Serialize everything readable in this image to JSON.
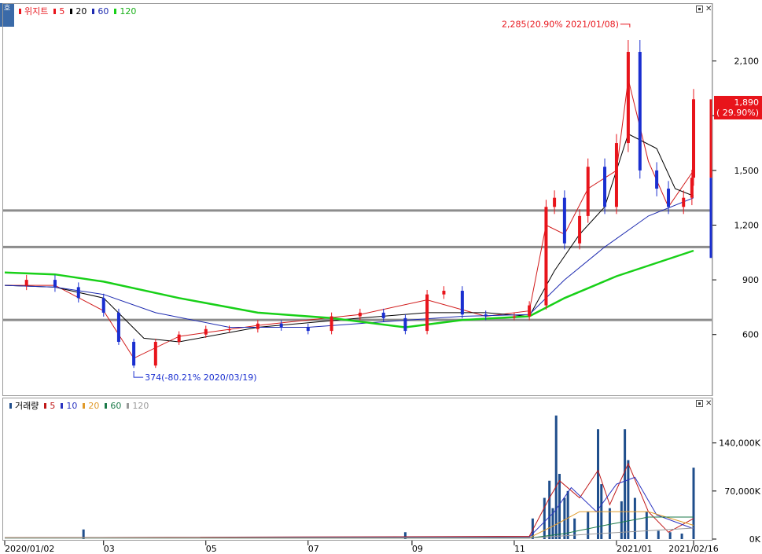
{
  "legend_price": {
    "title": "위지트",
    "ma5": "5",
    "ma20": "20",
    "ma60": "60",
    "ma120": "120"
  },
  "legend_volume": {
    "title": "거래량",
    "ma5": "5",
    "ma10": "10",
    "ma20": "20",
    "ma60": "60",
    "ma120": "120"
  },
  "badge": "호",
  "price_tag": {
    "price": "1,890",
    "change": "( 29.90%)"
  },
  "annotations": {
    "high": "2,285(20.90% 2021/01/08)",
    "low": "374(-80.21% 2020/03/19)"
  },
  "colors": {
    "up": "#e8141b",
    "down": "#1a2fd0",
    "ma5": "#d11a1a",
    "ma20": "#000000",
    "ma60": "#1e2bb0",
    "ma120": "#18d018",
    "hline": "#8c8c8c",
    "vol": "#1f4e8c",
    "vma5": "#c01818",
    "vma10": "#2a33c0",
    "vma20": "#e09a2a",
    "vma60": "#1b7a4a",
    "vma120": "#999999"
  },
  "chart_data": [
    {
      "type": "line",
      "panel": "price",
      "yticks": [
        "2,100",
        "1,800",
        "1,500",
        "1,200",
        "900",
        "600"
      ],
      "ytick_values": [
        2100,
        1800,
        1500,
        1200,
        900,
        600
      ],
      "ylim": [
        280,
        2400
      ],
      "xlabels": [
        "2020/01/02",
        "03",
        "05",
        "07",
        "09",
        "11",
        "2021/01",
        "2021/02/16"
      ],
      "xlabel_dates": [
        "2020-01-02",
        "2020-03-01",
        "2020-05-01",
        "2020-07-01",
        "2020-09-01",
        "2020-11-01",
        "2021-01-01",
        "2021-02-16"
      ],
      "horizontal_lines": [
        1280,
        1080,
        680
      ],
      "high": {
        "date": "2021-01-08",
        "value": 2285
      },
      "low": {
        "date": "2020-03-19",
        "value": 374
      },
      "last": {
        "date": "2021-02-16",
        "value": 1890
      },
      "series": [
        {
          "name": "종가",
          "dates": [
            "2020-01-02",
            "2020-01-15",
            "2020-02-01",
            "2020-02-15",
            "2020-03-01",
            "2020-03-10",
            "2020-03-19",
            "2020-04-01",
            "2020-04-15",
            "2020-05-01",
            "2020-05-15",
            "2020-06-01",
            "2020-06-15",
            "2020-07-01",
            "2020-07-15",
            "2020-08-01",
            "2020-08-15",
            "2020-08-28",
            "2020-09-10",
            "2020-09-20",
            "2020-10-01",
            "2020-10-15",
            "2020-11-01",
            "2020-11-10",
            "2020-11-20",
            "2020-11-25",
            "2020-12-01",
            "2020-12-10",
            "2020-12-15",
            "2020-12-25",
            "2021-01-01",
            "2021-01-08",
            "2021-01-15",
            "2021-01-25",
            "2021-02-01",
            "2021-02-10",
            "2021-02-15",
            "2021-02-16"
          ],
          "values": [
            870,
            900,
            860,
            800,
            720,
            560,
            430,
            560,
            600,
            630,
            630,
            660,
            640,
            620,
            700,
            720,
            690,
            620,
            820,
            840,
            710,
            700,
            700,
            760,
            1300,
            1350,
            1100,
            1250,
            1520,
            1300,
            1650,
            2150,
            1500,
            1400,
            1300,
            1350,
            1460,
            1890
          ]
        },
        {
          "name": "5",
          "dates": [
            "2020-01-02",
            "2020-02-01",
            "2020-03-01",
            "2020-03-19",
            "2020-04-15",
            "2020-06-01",
            "2020-08-01",
            "2020-09-10",
            "2020-10-15",
            "2020-11-10",
            "2020-11-20",
            "2020-12-01",
            "2020-12-15",
            "2021-01-01",
            "2021-01-08",
            "2021-01-20",
            "2021-02-01",
            "2021-02-16"
          ],
          "values": [
            870,
            870,
            730,
            470,
            590,
            650,
            710,
            790,
            700,
            730,
            1200,
            1150,
            1400,
            1500,
            2000,
            1550,
            1300,
            1500
          ]
        },
        {
          "name": "20",
          "dates": [
            "2020-01-02",
            "2020-02-01",
            "2020-03-01",
            "2020-03-25",
            "2020-04-15",
            "2020-06-01",
            "2020-08-01",
            "2020-09-10",
            "2020-10-15",
            "2020-11-10",
            "2020-11-25",
            "2020-12-10",
            "2020-12-25",
            "2021-01-08",
            "2021-01-25",
            "2021-02-05",
            "2021-02-16"
          ],
          "values": [
            870,
            860,
            800,
            580,
            560,
            640,
            690,
            720,
            720,
            700,
            950,
            1150,
            1300,
            1700,
            1620,
            1400,
            1360
          ]
        },
        {
          "name": "60",
          "dates": [
            "2020-01-02",
            "2020-02-01",
            "2020-03-01",
            "2020-04-01",
            "2020-05-15",
            "2020-07-01",
            "2020-08-15",
            "2020-10-01",
            "2020-11-10",
            "2020-12-01",
            "2020-12-25",
            "2021-01-20",
            "2021-02-16"
          ],
          "values": [
            870,
            860,
            820,
            720,
            640,
            640,
            670,
            700,
            710,
            900,
            1080,
            1250,
            1350
          ]
        },
        {
          "name": "120",
          "dates": [
            "2020-01-02",
            "2020-02-01",
            "2020-03-01",
            "2020-04-15",
            "2020-06-01",
            "2020-07-15",
            "2020-08-28",
            "2020-10-01",
            "2020-11-10",
            "2020-12-01",
            "2021-01-01",
            "2021-02-16"
          ],
          "values": [
            940,
            930,
            890,
            800,
            720,
            690,
            640,
            680,
            700,
            800,
            920,
            1060
          ]
        }
      ]
    },
    {
      "type": "bar",
      "panel": "volume",
      "yticks": [
        "140,000K",
        "70,000K",
        "0K"
      ],
      "ytick_values": [
        140000,
        70000,
        0
      ],
      "ylim": [
        0,
        190000
      ],
      "series": [
        {
          "name": "거래량",
          "dates": [
            "2020-02-18",
            "2020-08-28",
            "2020-11-12",
            "2020-11-19",
            "2020-11-22",
            "2020-11-24",
            "2020-11-26",
            "2020-11-28",
            "2020-12-01",
            "2020-12-03",
            "2020-12-07",
            "2020-12-15",
            "2020-12-21",
            "2020-12-23",
            "2020-12-28",
            "2021-01-04",
            "2021-01-06",
            "2021-01-08",
            "2021-01-12",
            "2021-01-19",
            "2021-01-26",
            "2021-02-02",
            "2021-02-09",
            "2021-02-16"
          ],
          "values": [
            14000,
            10000,
            30000,
            60000,
            85000,
            45000,
            180000,
            95000,
            60000,
            70000,
            30000,
            40000,
            160000,
            80000,
            45000,
            55000,
            160000,
            115000,
            60000,
            40000,
            12000,
            10000,
            8000,
            104000
          ]
        },
        {
          "name": "5",
          "dates": [
            "2020-01-02",
            "2020-11-10",
            "2020-11-22",
            "2020-11-28",
            "2020-12-10",
            "2020-12-21",
            "2020-12-28",
            "2021-01-08",
            "2021-01-20",
            "2021-02-01",
            "2021-02-16"
          ],
          "values": [
            2000,
            4000,
            60000,
            85000,
            60000,
            100000,
            50000,
            110000,
            40000,
            10000,
            30000
          ]
        },
        {
          "name": "10",
          "dates": [
            "2020-01-02",
            "2020-11-10",
            "2020-11-25",
            "2020-12-05",
            "2020-12-20",
            "2021-01-01",
            "2021-01-12",
            "2021-01-25",
            "2021-02-16"
          ],
          "values": [
            2000,
            3000,
            40000,
            75000,
            40000,
            80000,
            90000,
            35000,
            15000
          ]
        },
        {
          "name": "20",
          "dates": [
            "2020-01-02",
            "2020-11-10",
            "2020-11-25",
            "2020-12-10",
            "2021-01-01",
            "2021-01-20",
            "2021-02-16"
          ],
          "values": [
            2000,
            2000,
            20000,
            40000,
            40000,
            40000,
            20000
          ]
        },
        {
          "name": "60",
          "dates": [
            "2020-01-02",
            "2020-11-10",
            "2020-12-01",
            "2020-12-25",
            "2021-01-20",
            "2021-02-16"
          ],
          "values": [
            1500,
            1500,
            8000,
            20000,
            32000,
            32000
          ]
        },
        {
          "name": "120",
          "dates": [
            "2020-01-02",
            "2020-11-10",
            "2020-12-15",
            "2021-02-16"
          ],
          "values": [
            1500,
            1500,
            7000,
            16000
          ]
        }
      ]
    }
  ]
}
